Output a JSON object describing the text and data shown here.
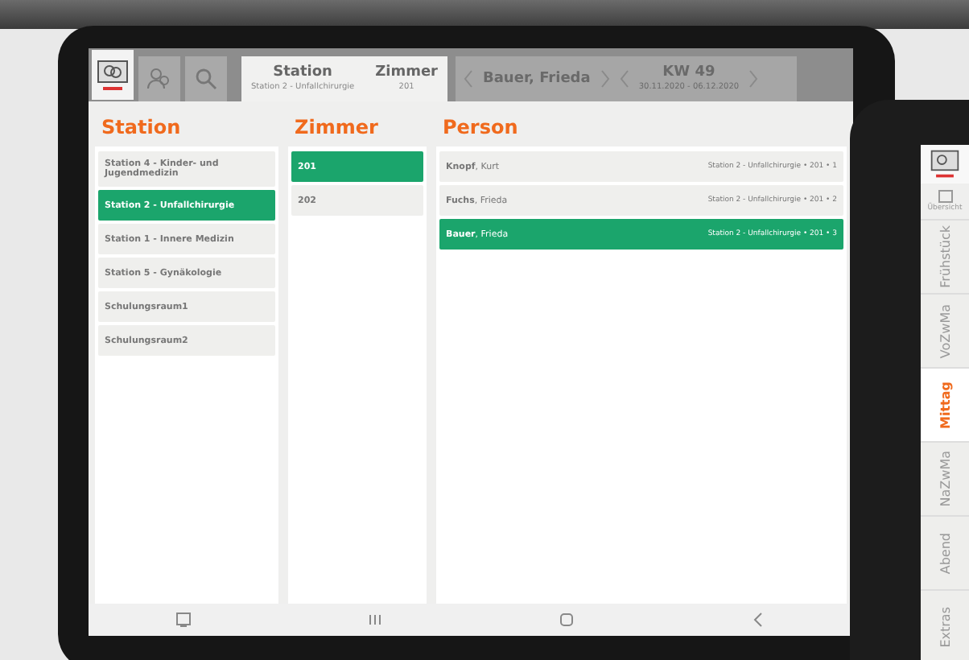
{
  "header": {
    "station_tab": {
      "label": "Station",
      "value": "Station 2 - Unfallchirurgie"
    },
    "room_tab": {
      "label": "Zimmer",
      "value": "201"
    },
    "person_nav": {
      "name": "Bauer, Frieda"
    },
    "week_nav": {
      "week": "KW 49",
      "range": "30.11.2020 - 06.12.2020"
    }
  },
  "stations": {
    "title": "Station",
    "items": [
      {
        "label": "Station 4 - Kinder- und Jugendmedizin",
        "selected": false
      },
      {
        "label": "Station 2 - Unfallchirurgie",
        "selected": true
      },
      {
        "label": "Station 1 - Innere Medizin",
        "selected": false
      },
      {
        "label": "Station 5 - Gynäkologie",
        "selected": false
      },
      {
        "label": "Schulungsraum1",
        "selected": false
      },
      {
        "label": "Schulungsraum2",
        "selected": false
      }
    ]
  },
  "rooms": {
    "title": "Zimmer",
    "items": [
      {
        "label": "201",
        "selected": true
      },
      {
        "label": "202",
        "selected": false
      }
    ]
  },
  "persons": {
    "title": "Person",
    "items": [
      {
        "name": "**Knopf**, Kurt",
        "detail": "Station 2 - Unfallchirurgie • 201 • 1",
        "selected": false
      },
      {
        "name": "**Fuchs**, Frieda",
        "detail": "Station 2 - Unfallchirurgie • 201 • 2",
        "selected": false
      },
      {
        "name": "**Bauer**, Frieda",
        "detail": "Station 2 - Unfallchirurgie • 201 • 3",
        "selected": true
      }
    ]
  },
  "second_tablet": {
    "overview": "Übersicht",
    "meals": [
      {
        "label": "Frühstück",
        "selected": false
      },
      {
        "label": "VoZwMa",
        "selected": false
      },
      {
        "label": "Mittag",
        "selected": true
      },
      {
        "label": "NaZwMa",
        "selected": false
      },
      {
        "label": "Abend",
        "selected": false
      },
      {
        "label": "Extras",
        "selected": false
      }
    ]
  }
}
